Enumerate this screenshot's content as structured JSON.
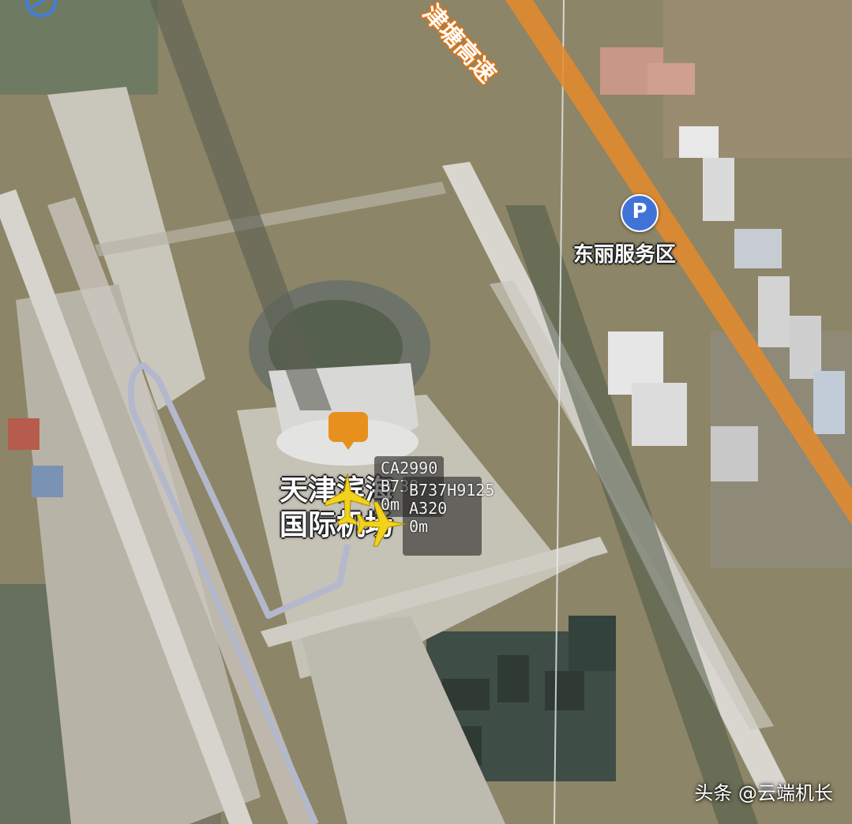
{
  "map": {
    "airport_label_line1": "天津滨海",
    "airport_label_line2": "国际机场",
    "service_area_label": "东丽服务区",
    "parking_icon_glyph": "P",
    "expressway_label": "津塘高速",
    "watermark": "头条 @云端机长"
  },
  "flights": [
    {
      "callsign": "CA2990",
      "aircraft": "B738",
      "altitude": "0m"
    },
    {
      "callsign": "B737H9125",
      "aircraft": "A320",
      "altitude": "0m"
    }
  ],
  "icons": {
    "airport": "airport-pin-icon",
    "aircraft": "aircraft-icon",
    "parking": "parking-icon",
    "compass": "compass-icon"
  },
  "colors": {
    "expressway": "#e58a2c",
    "airport_pin": "#e8901e",
    "aircraft": "#f2d21a",
    "parking_pin": "#3f73d8",
    "flight_track": "#b4b8cc"
  }
}
